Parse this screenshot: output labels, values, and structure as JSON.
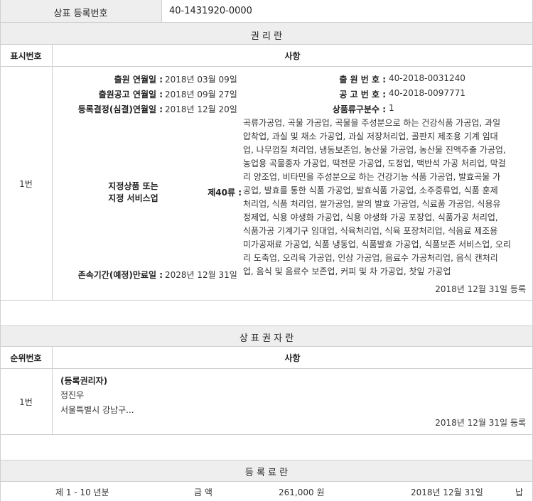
{
  "top": {
    "label": "상표 등록번호",
    "value": "40-1431920-0000"
  },
  "rights": {
    "section_title": "권 리 란",
    "col_no": "표시번호",
    "col_item": "사항",
    "row_no": "1번",
    "filing_date_label": "출원 연월일 :",
    "filing_date": "2018년 03월 09일",
    "filing_no_label": "출 원 번 호 :",
    "filing_no": "40-2018-0031240",
    "pub_date_label": "출원공고 연월일 :",
    "pub_date": "2018년 09월 27일",
    "pub_no_label": "공 고 번 호 :",
    "pub_no": "40-2018-0097771",
    "decision_label": "등록결정(심결)연월일 :",
    "decision_date": "2018년 12월 20일",
    "class_count_label": "상품류구분수 :",
    "class_count": "1",
    "goods_label_1": "지정상품 또는",
    "goods_label_2": "지정 서비스업",
    "class_label": "제40류 :",
    "goods_lines": [
      "곡류가공업, 곡물 가공업, 곡물을 주성분으로 하는 건강식품 가공업, 과일",
      "압착업, 과실 및 채소 가공업, 과실 저장처리업, 골판지 제조용 기계 임대",
      "업, 나무껍질 처리업, 냉동보존업, 농산물 가공업, 농산물 진액추출 가공업,",
      "농업용 곡물종자 가공업, 떡전문 가공업, 도정업, 맥반석 가공 처리업, 막걸",
      "리 양조업, 비타민을 주성분으로 하는 건강기능 식품 가공업, 발효곡물 가",
      "공업, 발효를 통한 식품 가공업, 발효식품 가공업, 소주증류업, 식품 훈제",
      "처리업, 식품 처리업, 쌀가공업, 쌀의 발효 가공업, 식료품 가공업, 식용유",
      "정제업, 식용 야생화 가공업, 식용 야생화 가공 포장업, 식품가공 처리업,",
      "식품가공 기계기구 임대업, 식육처리업, 식육 포장처리업, 식음료 제조용",
      "미가공재료 가공업, 식품 냉동업, 식품발효 가공업, 식품보존 서비스업, 오리",
      "리 도축업, 오리육 가공업, 인삼 가공업, 음료수 가공처리업, 음식 캔처리",
      "업, 음식 및 음료수 보존업, 커피 및 차 가공업, 찻잎 가공업"
    ],
    "expiry_label": "존속기간(예정)만료일 :",
    "expiry_date": "2028년 12월 31일",
    "reg_note": "2018년 12월 31일 등록"
  },
  "holder": {
    "section_title": "상 표 권 자 란",
    "col_no": "순위번호",
    "col_item": "사항",
    "row_no": "1번",
    "kind": "(등록권리자)",
    "name": "정진우",
    "address": "서울특별시 강남구...",
    "reg_note": "2018년 12월 31일 등록"
  },
  "fees": {
    "section_title": "등 록 료 란",
    "period": "제 1 - 10 년분",
    "amount_label": "금 액",
    "amount": "261,000 원",
    "date": "2018년 12월 31일",
    "status_partial": "납"
  }
}
